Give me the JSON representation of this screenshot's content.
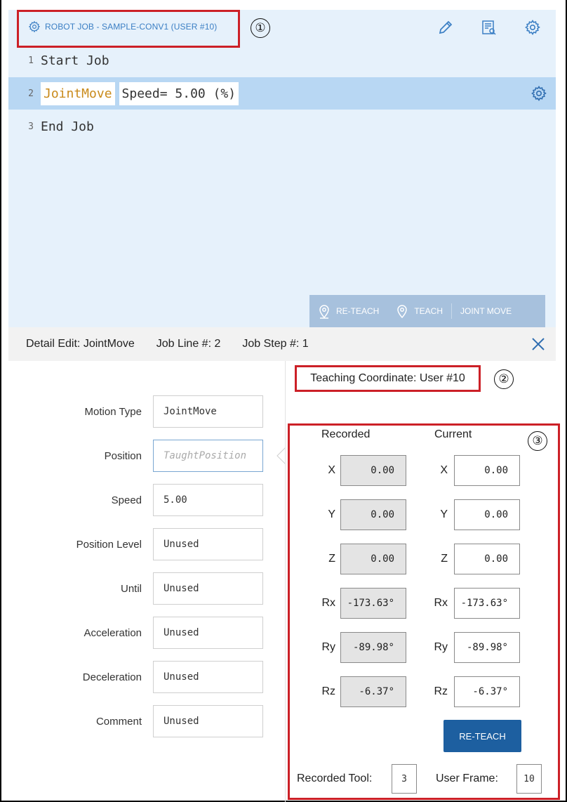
{
  "header": {
    "job_title": "ROBOT JOB - SAMPLE-CONV1 (USER #10)",
    "icons": [
      "pencil-icon",
      "preview-icon",
      "gear-icon"
    ]
  },
  "program": {
    "lines": [
      {
        "num": "1",
        "text": "Start Job"
      },
      {
        "num": "2",
        "command": "JointMove",
        "param": "Speed= 5.00 (%)"
      },
      {
        "num": "3",
        "text": "End Job"
      }
    ]
  },
  "actions": {
    "reteach": "RE-TEACH",
    "teach": "TEACH",
    "jointmove": "JOINT MOVE"
  },
  "detail": {
    "title": "Detail Edit: JointMove",
    "job_line": "Job Line #: 2",
    "job_step": "Job Step #: 1"
  },
  "form": {
    "motion_type": {
      "label": "Motion Type",
      "value": "JointMove"
    },
    "position": {
      "label": "Position",
      "placeholder": "TaughtPosition"
    },
    "speed": {
      "label": "Speed",
      "value": "5.00"
    },
    "position_level": {
      "label": "Position Level",
      "value": "Unused"
    },
    "until": {
      "label": "Until",
      "value": "Unused"
    },
    "acceleration": {
      "label": "Acceleration",
      "value": "Unused"
    },
    "deceleration": {
      "label": "Deceleration",
      "value": "Unused"
    },
    "comment": {
      "label": "Comment",
      "value": "Unused"
    }
  },
  "teaching": {
    "coordinate": "Teaching Coordinate: User #10",
    "recorded_header": "Recorded",
    "current_header": "Current",
    "rows": [
      {
        "axis": "X",
        "recorded": "0.00",
        "current": "0.00"
      },
      {
        "axis": "Y",
        "recorded": "0.00",
        "current": "0.00"
      },
      {
        "axis": "Z",
        "recorded": "0.00",
        "current": "0.00"
      },
      {
        "axis": "Rx",
        "recorded": "-173.63°",
        "current": "-173.63°"
      },
      {
        "axis": "Ry",
        "recorded": "-89.98°",
        "current": "-89.98°"
      },
      {
        "axis": "Rz",
        "recorded": "-6.37°",
        "current": "-6.37°"
      }
    ],
    "reteach_button": "RE-TEACH",
    "recorded_tool_label": "Recorded Tool:",
    "recorded_tool_value": "3",
    "user_frame_label": "User Frame:",
    "user_frame_value": "10"
  },
  "callouts": [
    "①",
    "②",
    "③"
  ],
  "colors": {
    "editor_bg": "#e6f1fb",
    "selected_line": "#b8d7f3",
    "accent_blue": "#3b7fc4",
    "button_blue": "#1d5fa0",
    "callout_red": "#cc2027",
    "keyword_orange": "#c98a1a"
  }
}
